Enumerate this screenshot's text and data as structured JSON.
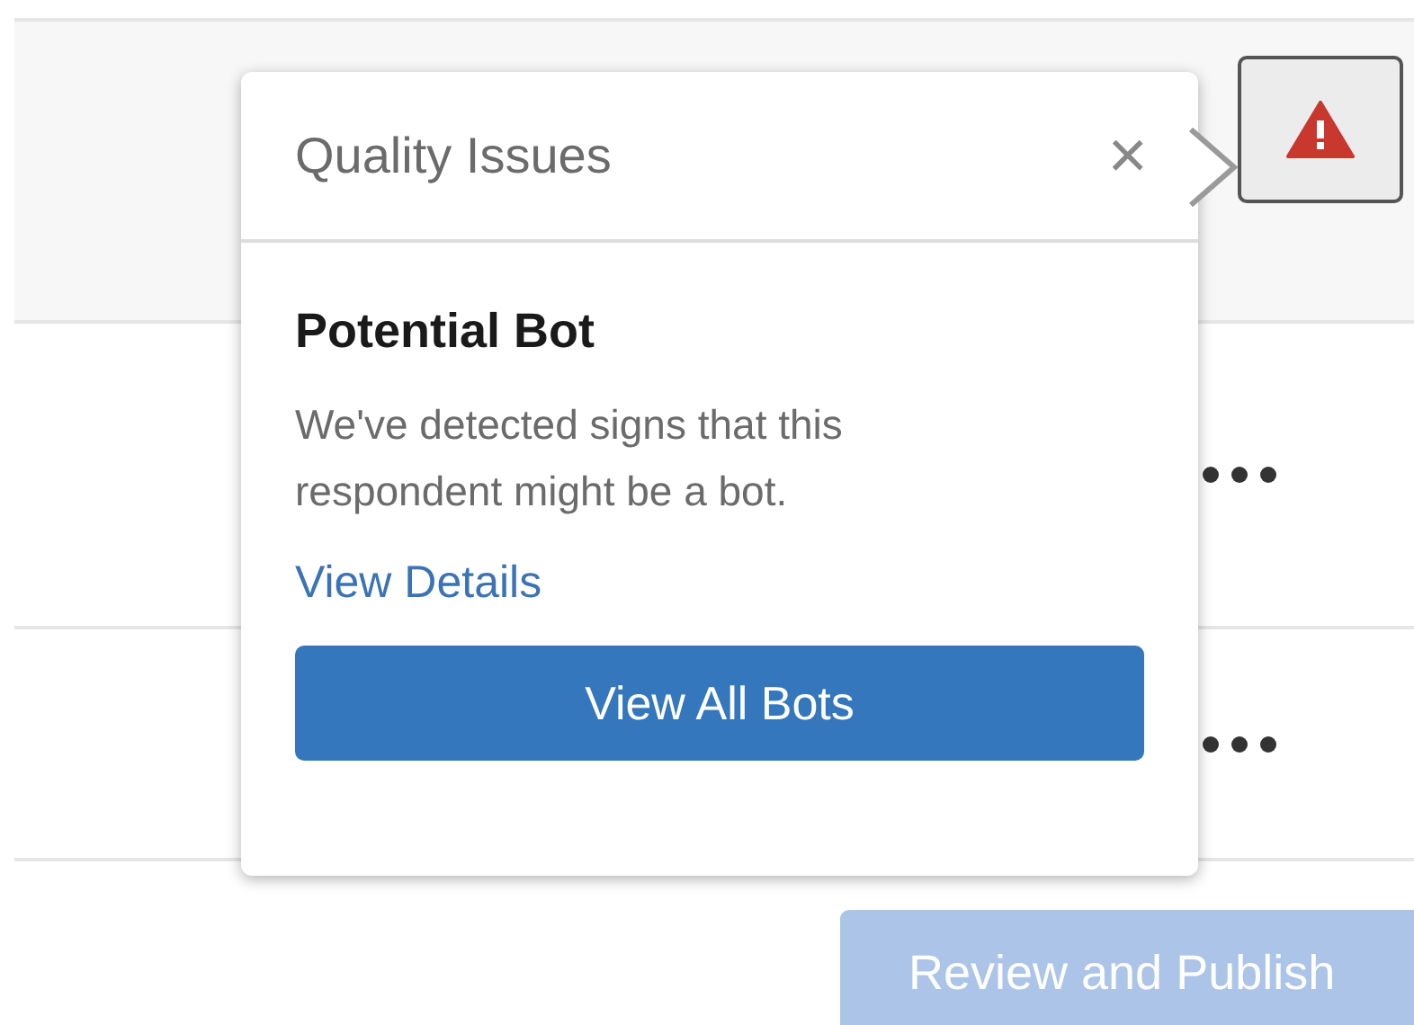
{
  "rows": [
    {
      "kind": "warning"
    },
    {
      "kind": "more"
    },
    {
      "kind": "more"
    }
  ],
  "popover": {
    "title": "Quality Issues",
    "close": "×",
    "heading": "Potential Bot",
    "message": "We've detected signs that this respondent might be a bot.",
    "link": "View Details",
    "button": "View All Bots"
  },
  "publish_button": {
    "label": "Review and Publish",
    "disabled": true
  }
}
